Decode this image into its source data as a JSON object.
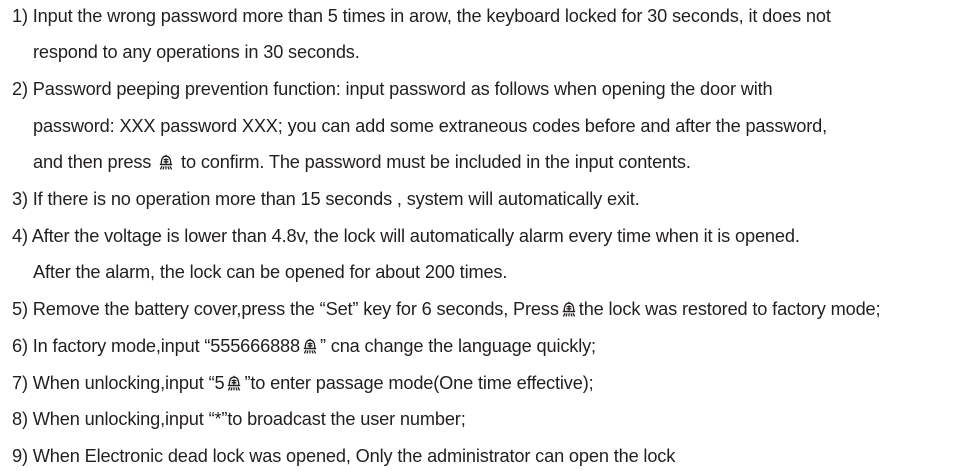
{
  "instructions": {
    "item1": {
      "line1": "1) Input the wrong password more than 5 times in arow, the keyboard locked for 30 seconds, it does not",
      "line2": "respond to any operations in 30 seconds."
    },
    "item2": {
      "line1": "2) Password peeping prevention function: input password as follows when opening the door with",
      "line2": "password: XXX password XXX; you can add some extraneous codes before and after the password,",
      "line3_before_icon": "and then press",
      "line3_after_icon": "to confirm. The password must be included in the input contents."
    },
    "item3": {
      "line1": "3) If there is no operation more than 15 seconds , system will automatically exit."
    },
    "item4": {
      "line1": "4) After the voltage is lower than 4.8v, the lock will automatically alarm every time when it is opened.",
      "line2": "After the alarm, the lock can be opened for about 200 times."
    },
    "item5": {
      "line1_before_icon": "5) Remove the battery cover,press the “Set” key for 6 seconds, Press",
      "line1_after_icon": "the lock was restored to factory mode;"
    },
    "item6": {
      "line1_before_icon": "6) In factory mode,input “555666888",
      "line1_after_icon": "” cna change the language quickly;"
    },
    "item7": {
      "line1_before_icon": "7) When unlocking,input “5",
      "line1_after_icon": "”to enter passage mode(One time effective);"
    },
    "item8": {
      "line1": "8) When unlocking,input “*”to broadcast the user number;"
    },
    "item9": {
      "line1": "9) When Electronic dead lock was opened, Only the administrator can open the lock"
    }
  },
  "icons": {
    "confirm_key": "bell-key-icon"
  },
  "colors": {
    "text": "#231f20",
    "background": "#ffffff"
  }
}
